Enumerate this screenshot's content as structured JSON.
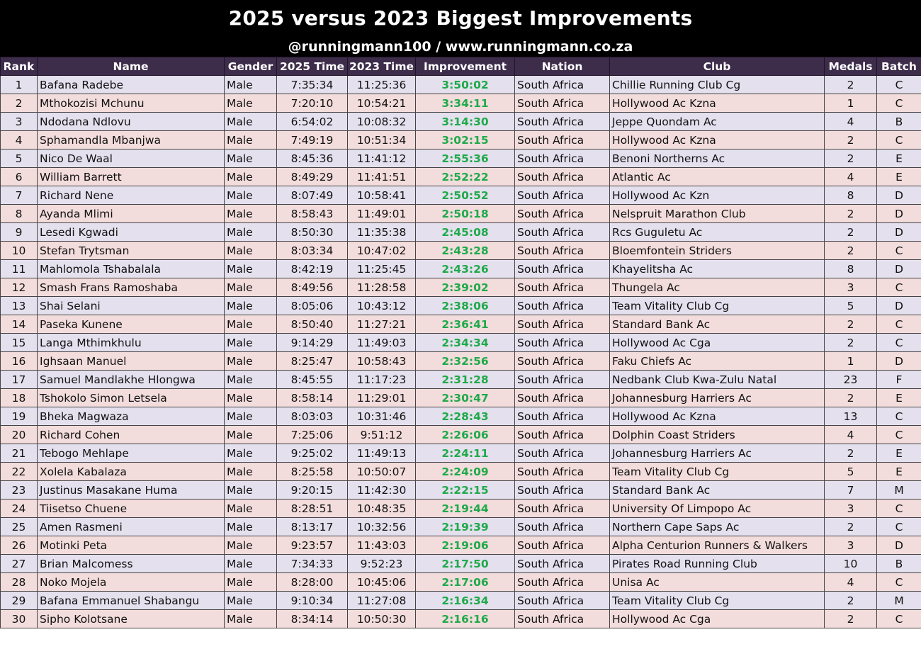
{
  "header": {
    "title": "2025 versus 2023 Biggest Improvements",
    "subtitle": "@runningmann100 / www.runningmann.co.za"
  },
  "colors": {
    "banner": "#000000",
    "header_row": "#3d2c4a",
    "row_odd": "#e4e0ee",
    "row_even": "#f3dcdc",
    "improvement": "#1faa4a"
  },
  "table": {
    "columns": [
      "Rank",
      "Name",
      "Gender",
      "2025 Time",
      "2023 Time",
      "Improvement",
      "Nation",
      "Club",
      "Medals",
      "Batch"
    ],
    "rows": [
      [
        "1",
        "Bafana Radebe",
        "Male",
        "7:35:34",
        "11:25:36",
        "3:50:02",
        "South Africa",
        "Chillie Running Club Cg",
        "2",
        "C"
      ],
      [
        "2",
        "Mthokozisi Mchunu",
        "Male",
        "7:20:10",
        "10:54:21",
        "3:34:11",
        "South Africa",
        "Hollywood Ac Kzna",
        "1",
        "C"
      ],
      [
        "3",
        "Ndodana Ndlovu",
        "Male",
        "6:54:02",
        "10:08:32",
        "3:14:30",
        "South Africa",
        "Jeppe Quondam Ac",
        "4",
        "B"
      ],
      [
        "4",
        "Sphamandla Mbanjwa",
        "Male",
        "7:49:19",
        "10:51:34",
        "3:02:15",
        "South Africa",
        "Hollywood Ac Kzna",
        "2",
        "C"
      ],
      [
        "5",
        "Nico De Waal",
        "Male",
        "8:45:36",
        "11:41:12",
        "2:55:36",
        "South Africa",
        "Benoni Northerns Ac",
        "2",
        "E"
      ],
      [
        "6",
        "William Barrett",
        "Male",
        "8:49:29",
        "11:41:51",
        "2:52:22",
        "South Africa",
        "Atlantic Ac",
        "4",
        "E"
      ],
      [
        "7",
        "Richard Nene",
        "Male",
        "8:07:49",
        "10:58:41",
        "2:50:52",
        "South Africa",
        "Hollywood Ac Kzn",
        "8",
        "D"
      ],
      [
        "8",
        "Ayanda Mlimi",
        "Male",
        "8:58:43",
        "11:49:01",
        "2:50:18",
        "South Africa",
        "Nelspruit Marathon Club",
        "2",
        "D"
      ],
      [
        "9",
        "Lesedi Kgwadi",
        "Male",
        "8:50:30",
        "11:35:38",
        "2:45:08",
        "South Africa",
        "Rcs Guguletu Ac",
        "2",
        "D"
      ],
      [
        "10",
        "Stefan Trytsman",
        "Male",
        "8:03:34",
        "10:47:02",
        "2:43:28",
        "South Africa",
        "Bloemfontein Striders",
        "2",
        "C"
      ],
      [
        "11",
        "Mahlomola Tshabalala",
        "Male",
        "8:42:19",
        "11:25:45",
        "2:43:26",
        "South Africa",
        "Khayelitsha Ac",
        "8",
        "D"
      ],
      [
        "12",
        "Smash Frans Ramoshaba",
        "Male",
        "8:49:56",
        "11:28:58",
        "2:39:02",
        "South Africa",
        "Thungela Ac",
        "3",
        "C"
      ],
      [
        "13",
        "Shai Selani",
        "Male",
        "8:05:06",
        "10:43:12",
        "2:38:06",
        "South Africa",
        "Team Vitality Club Cg",
        "5",
        "D"
      ],
      [
        "14",
        "Paseka Kunene",
        "Male",
        "8:50:40",
        "11:27:21",
        "2:36:41",
        "South Africa",
        "Standard Bank Ac",
        "2",
        "C"
      ],
      [
        "15",
        "Langa Mthimkhulu",
        "Male",
        "9:14:29",
        "11:49:03",
        "2:34:34",
        "South Africa",
        "Hollywood Ac Cga",
        "2",
        "C"
      ],
      [
        "16",
        "Ighsaan Manuel",
        "Male",
        "8:25:47",
        "10:58:43",
        "2:32:56",
        "South Africa",
        "Faku Chiefs Ac",
        "1",
        "D"
      ],
      [
        "17",
        "Samuel Mandlakhe Hlongwa",
        "Male",
        "8:45:55",
        "11:17:23",
        "2:31:28",
        "South Africa",
        "Nedbank Club Kwa-Zulu Natal",
        "23",
        "F"
      ],
      [
        "18",
        "Tshokolo Simon Letsela",
        "Male",
        "8:58:14",
        "11:29:01",
        "2:30:47",
        "South Africa",
        "Johannesburg Harriers Ac",
        "2",
        "E"
      ],
      [
        "19",
        "Bheka Magwaza",
        "Male",
        "8:03:03",
        "10:31:46",
        "2:28:43",
        "South Africa",
        "Hollywood Ac Kzna",
        "13",
        "C"
      ],
      [
        "20",
        "Richard Cohen",
        "Male",
        "7:25:06",
        "9:51:12",
        "2:26:06",
        "South Africa",
        "Dolphin Coast Striders",
        "4",
        "C"
      ],
      [
        "21",
        "Tebogo Mehlape",
        "Male",
        "9:25:02",
        "11:49:13",
        "2:24:11",
        "South Africa",
        "Johannesburg Harriers Ac",
        "2",
        "E"
      ],
      [
        "22",
        "Xolela Kabalaza",
        "Male",
        "8:25:58",
        "10:50:07",
        "2:24:09",
        "South Africa",
        "Team Vitality Club Cg",
        "5",
        "E"
      ],
      [
        "23",
        "Justinus Masakane Huma",
        "Male",
        "9:20:15",
        "11:42:30",
        "2:22:15",
        "South Africa",
        "Standard Bank Ac",
        "7",
        "M"
      ],
      [
        "24",
        "Tiisetso Chuene",
        "Male",
        "8:28:51",
        "10:48:35",
        "2:19:44",
        "South Africa",
        "University Of Limpopo Ac",
        "3",
        "C"
      ],
      [
        "25",
        "Amen Rasmeni",
        "Male",
        "8:13:17",
        "10:32:56",
        "2:19:39",
        "South Africa",
        "Northern Cape Saps Ac",
        "2",
        "C"
      ],
      [
        "26",
        "Motinki Peta",
        "Male",
        "9:23:57",
        "11:43:03",
        "2:19:06",
        "South Africa",
        "Alpha Centurion Runners & Walkers",
        "3",
        "D"
      ],
      [
        "27",
        "Brian Malcomess",
        "Male",
        "7:34:33",
        "9:52:23",
        "2:17:50",
        "South Africa",
        "Pirates Road Running Club",
        "10",
        "B"
      ],
      [
        "28",
        "Noko Mojela",
        "Male",
        "8:28:00",
        "10:45:06",
        "2:17:06",
        "South Africa",
        "Unisa Ac",
        "4",
        "C"
      ],
      [
        "29",
        "Bafana Emmanuel Shabangu",
        "Male",
        "9:10:34",
        "11:27:08",
        "2:16:34",
        "South Africa",
        "Team Vitality Club Cg",
        "2",
        "M"
      ],
      [
        "30",
        "Sipho Kolotsane",
        "Male",
        "8:34:14",
        "10:50:30",
        "2:16:16",
        "South Africa",
        "Hollywood Ac Cga",
        "2",
        "C"
      ]
    ]
  }
}
